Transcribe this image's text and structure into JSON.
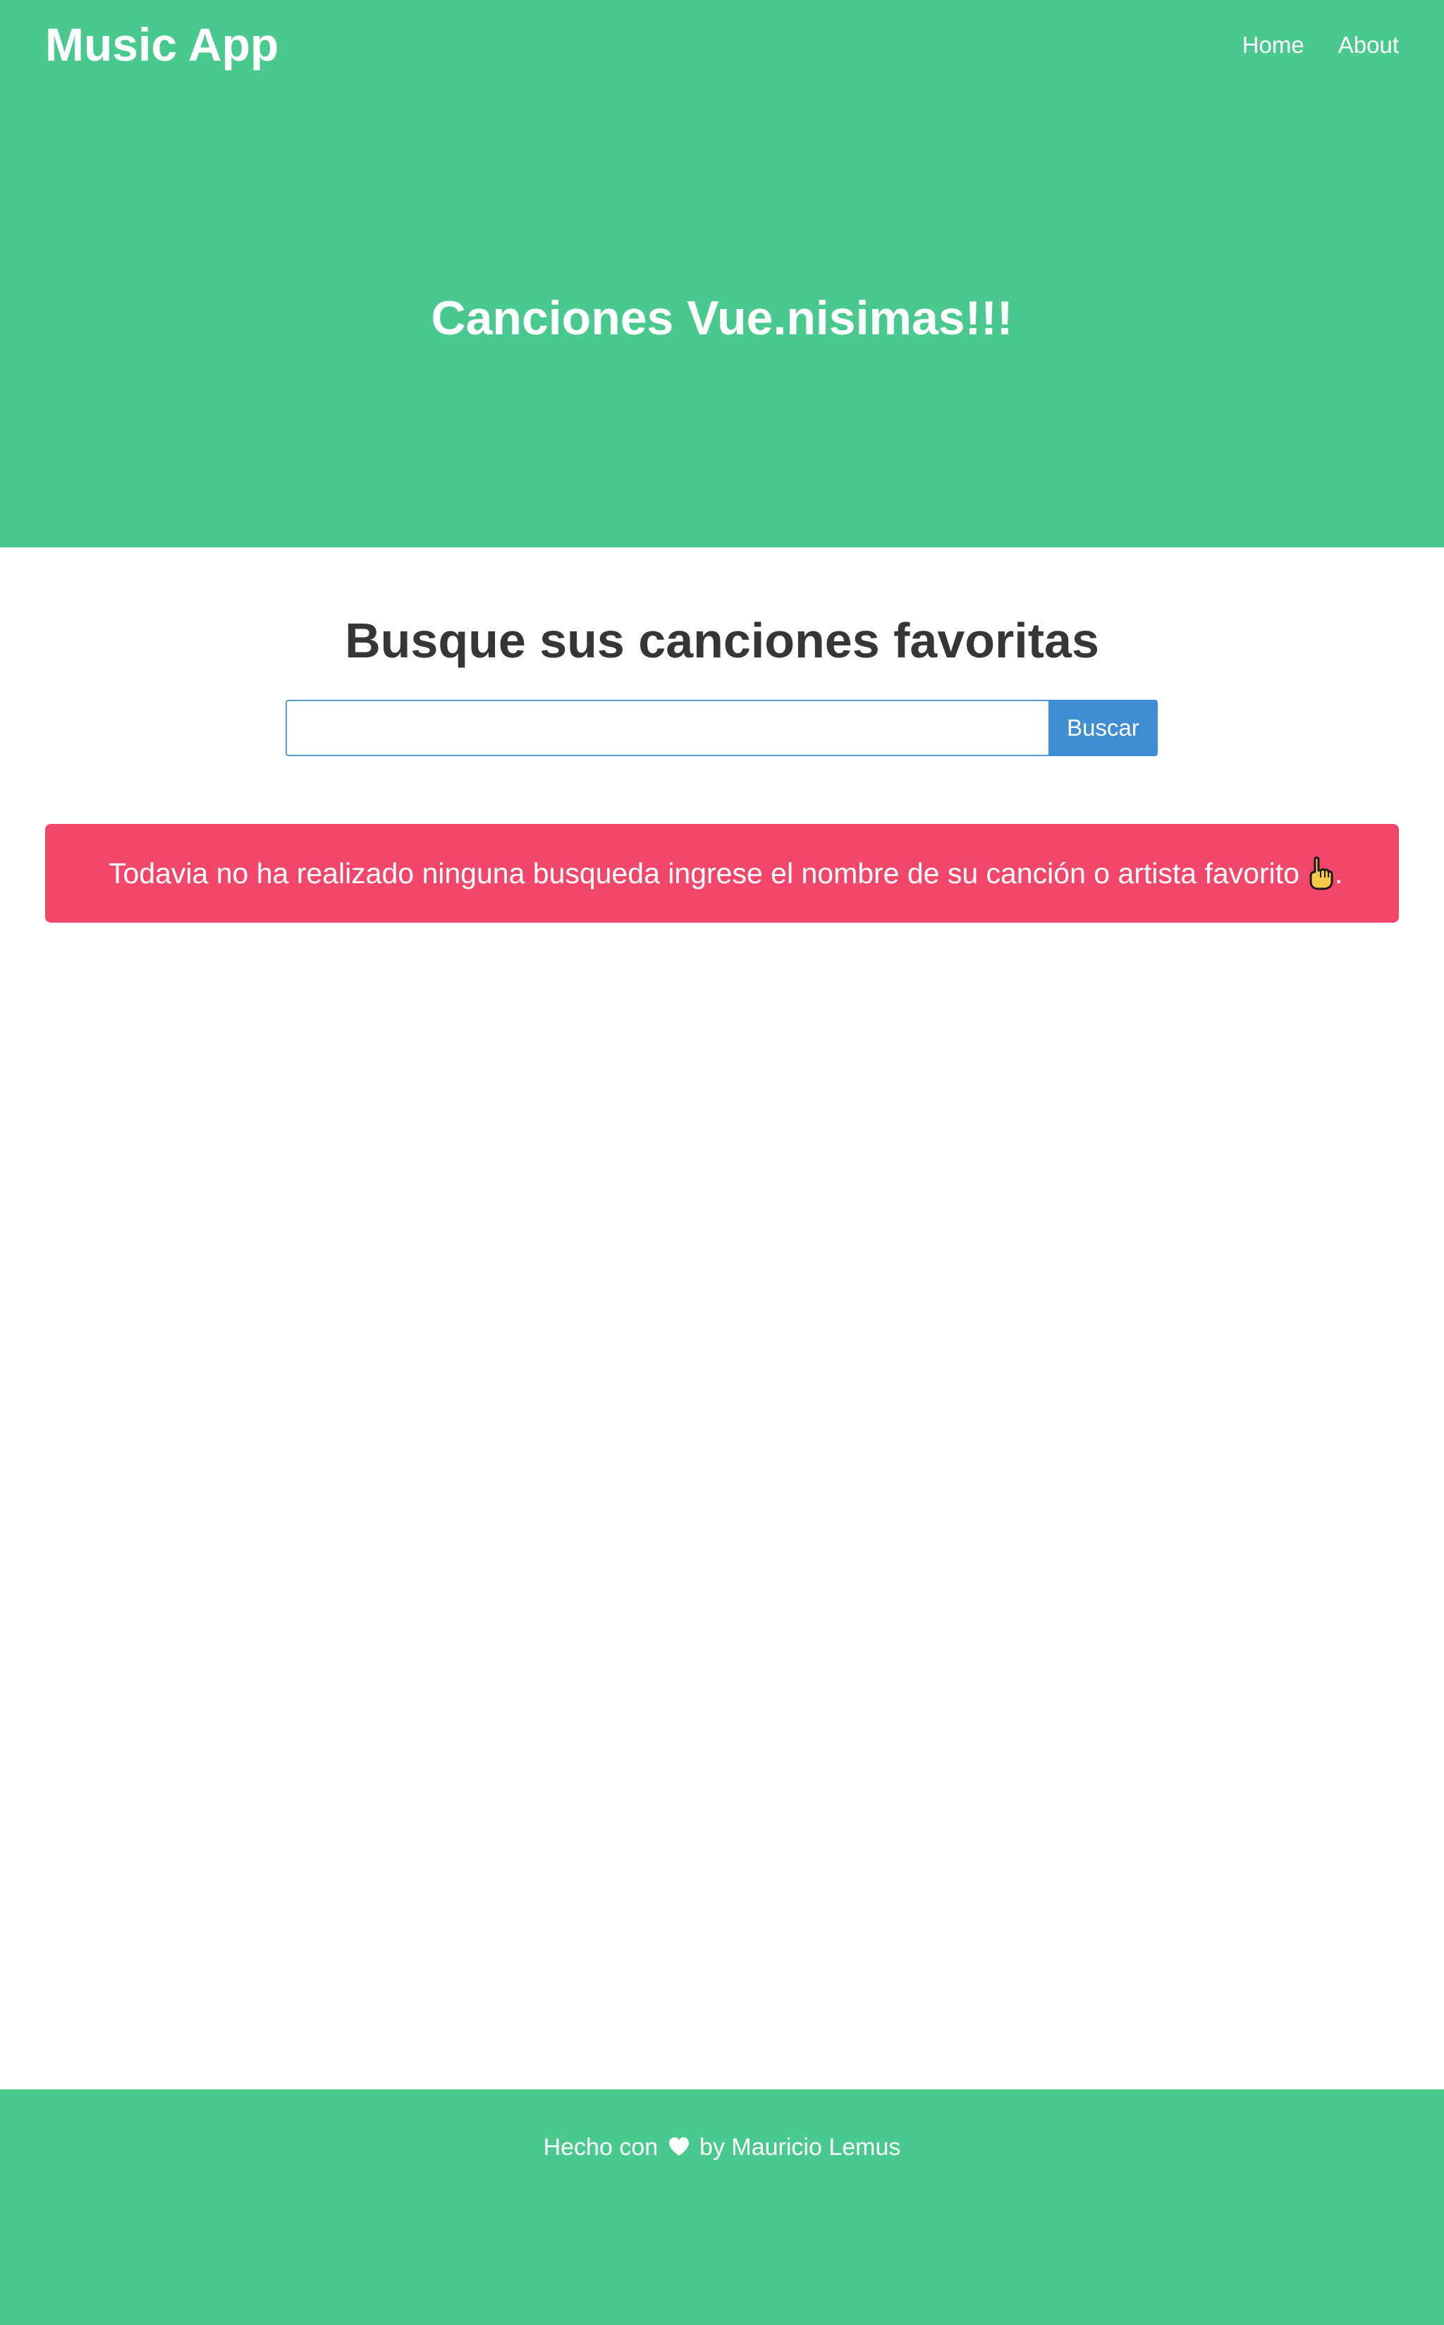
{
  "header": {
    "brand": "Music App",
    "nav": [
      {
        "label": "Home"
      },
      {
        "label": "About"
      }
    ]
  },
  "hero": {
    "title": "Canciones Vue.nisimas!!!"
  },
  "search": {
    "title": "Busque sus canciones favoritas",
    "input_value": "",
    "placeholder": "",
    "button_label": "Buscar"
  },
  "notification": {
    "text": "Todavia no ha realizado ninguna busqueda ingrese el nombre de su canción o artista favorito",
    "icon": "pointing-up-icon",
    "suffix": "."
  },
  "footer": {
    "prefix": "Hecho con",
    "icon": "heart-icon",
    "suffix": "by Mauricio Lemus"
  },
  "colors": {
    "brand_green": "#4ac98f",
    "button_blue": "#3f8ed2",
    "notification_red": "#f2476b",
    "title_text": "#363636"
  }
}
